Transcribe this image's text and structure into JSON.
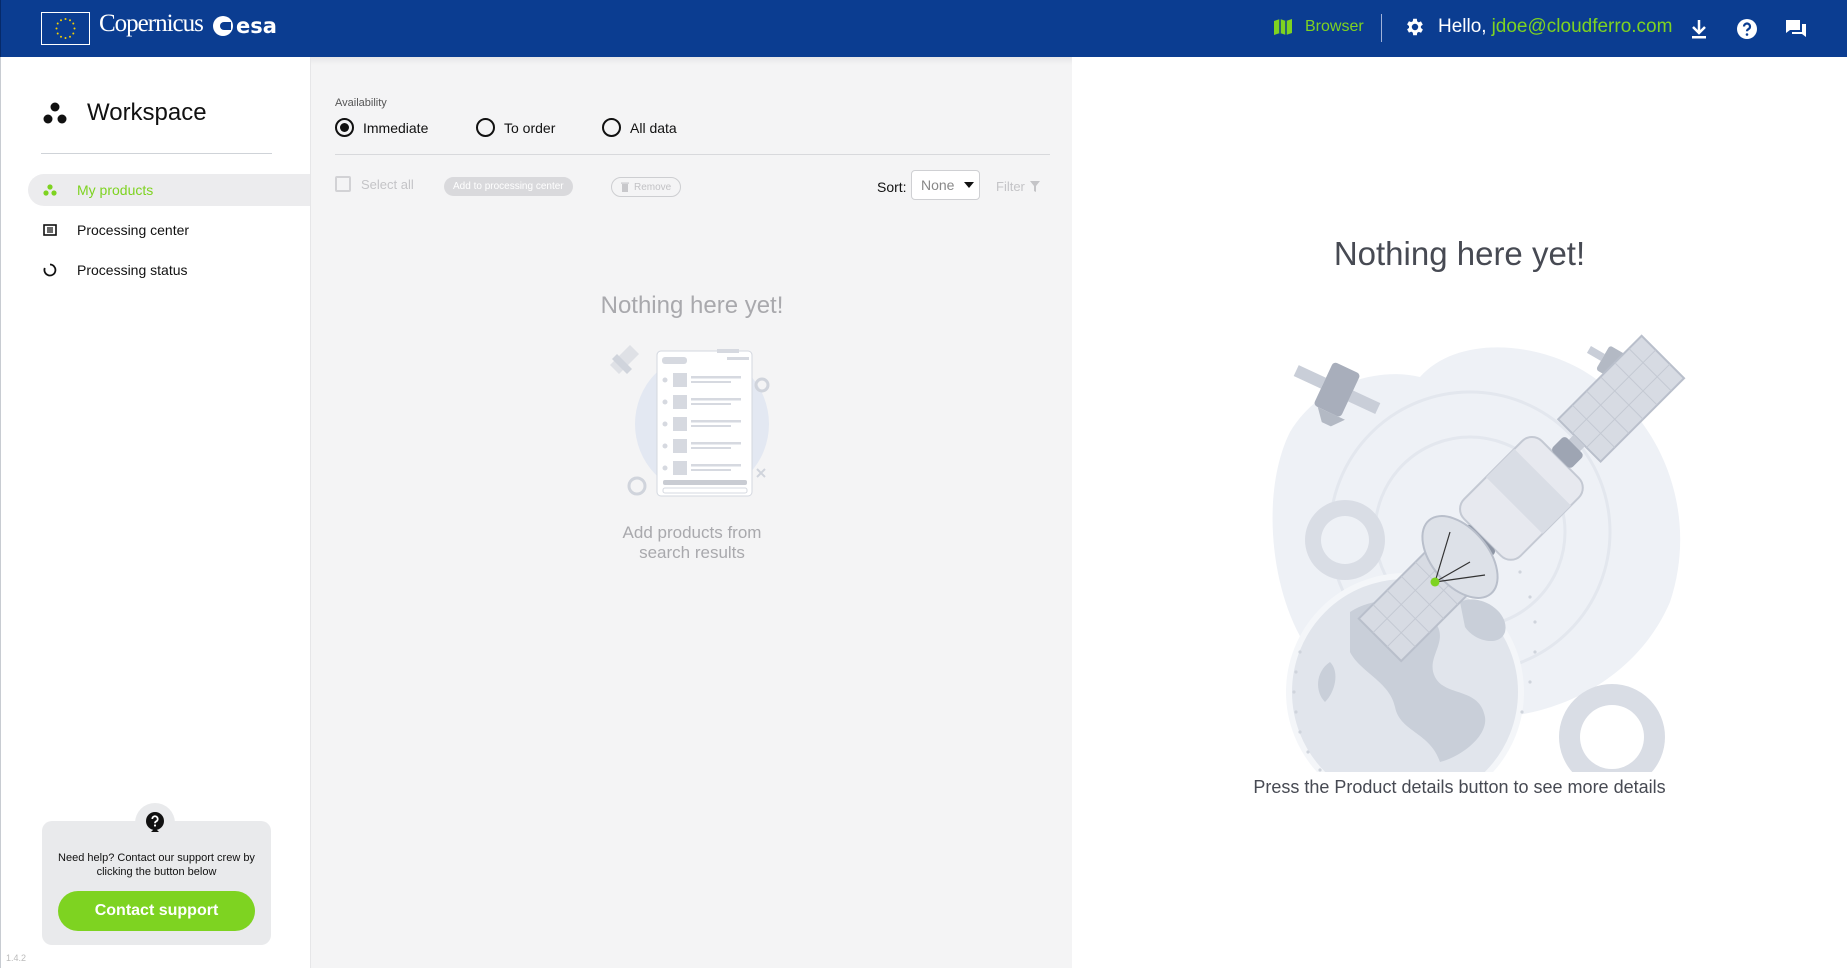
{
  "header": {
    "logo_text": "Copernicus",
    "esa_text": "esa",
    "browser_label": "Browser",
    "greeting_prefix": "Hello,",
    "user_email": "jdoe@cloudferro.com",
    "icons": [
      "map-icon",
      "gear-icon",
      "download-icon",
      "help-icon",
      "chat-icon"
    ]
  },
  "sidebar": {
    "title": "Workspace",
    "items": [
      {
        "label": "My products",
        "icon": "products-icon",
        "active": true
      },
      {
        "label": "Processing center",
        "icon": "processing-center-icon",
        "active": false
      },
      {
        "label": "Processing status",
        "icon": "processing-status-icon",
        "active": false
      }
    ],
    "help_text": "Need help? Contact our support crew by clicking the button below",
    "contact_label": "Contact support",
    "version": "1.4.2"
  },
  "products": {
    "availability_label": "Availability",
    "radios": [
      {
        "label": "Immediate",
        "selected": true
      },
      {
        "label": "To order",
        "selected": false
      },
      {
        "label": "All data",
        "selected": false
      }
    ],
    "select_all_label": "Select all",
    "add_label": "Add to processing center",
    "remove_label": "Remove",
    "sort_label": "Sort:",
    "sort_value": "None",
    "filter_label": "Filter",
    "empty_title": "Nothing here yet!",
    "empty_sub_line1": "Add products from",
    "empty_sub_line2": "search results"
  },
  "details": {
    "empty_title": "Nothing here yet!",
    "empty_sub": "Press the Product details button to see more details"
  },
  "colors": {
    "header_bg": "#0b3d91",
    "accent": "#7ed321",
    "panel_bg": "#f4f4f5"
  }
}
